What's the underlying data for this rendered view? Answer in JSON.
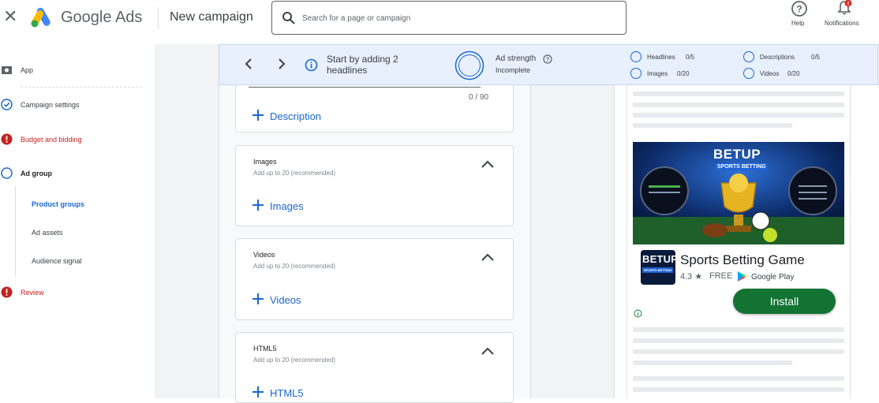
{
  "header": {
    "brand": "Google Ads",
    "campaign_title": "New campaign",
    "search_placeholder": "Search for a page or campaign",
    "help_label": "Help",
    "notifications_label": "Notifications"
  },
  "sidebar": {
    "items": [
      {
        "label": "App",
        "state": "app"
      },
      {
        "label": "Campaign settings",
        "state": "done"
      },
      {
        "label": "Budget and bidding",
        "state": "error"
      },
      {
        "label": "Ad group",
        "state": "current"
      },
      {
        "label": "Review",
        "state": "error"
      }
    ],
    "sub_items": [
      "Product groups",
      "Ad assets",
      "Audience signal"
    ]
  },
  "strength": {
    "message": "Start by adding 2 headlines",
    "title": "Ad strength",
    "status": "Incomplete",
    "checklist": [
      {
        "label": "Headlines",
        "count": "0/5"
      },
      {
        "label": "Descriptions",
        "count": "0/5"
      },
      {
        "label": "Images",
        "count": "0/20"
      },
      {
        "label": "Videos",
        "count": "0/20"
      }
    ]
  },
  "editor": {
    "description_counter": "0 / 90",
    "add_description_label": "Description",
    "cards": [
      {
        "title": "Images",
        "subtitle": "Add up to 20 (recommended)",
        "add_label": "Images"
      },
      {
        "title": "Videos",
        "subtitle": "Add up to 20 (recommended)",
        "add_label": "Videos"
      },
      {
        "title": "HTML5",
        "subtitle": "Add up to 20 (recommended)",
        "add_label": "HTML5"
      }
    ]
  },
  "preview": {
    "banner_brand": "BETUP",
    "banner_tagline": "SPORTS BETTING",
    "icon_brand": "BETUP",
    "icon_tagline": "SPORTS BETTING",
    "app_name": "Sports Betting Game",
    "rating": "4.3 ★",
    "price": "FREE",
    "store": "Google Play",
    "install_label": "Install"
  },
  "colors": {
    "accent": "#1967d2",
    "error": "#c5221f",
    "install": "#137333",
    "strength_bg": "#e8f0fe"
  }
}
